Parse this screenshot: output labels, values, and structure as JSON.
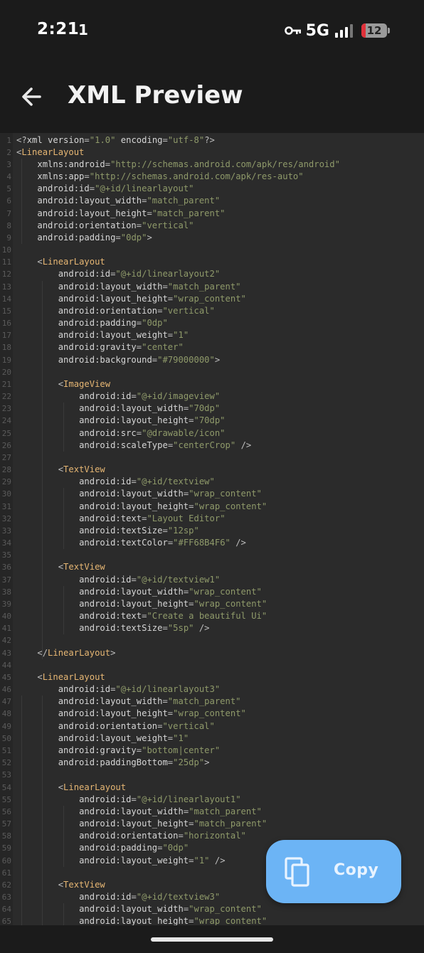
{
  "status_bar": {
    "time": "2:21",
    "sim_indicator": "1",
    "network": "5G",
    "battery_level": "12",
    "icons": [
      "key-icon",
      "signal-icon",
      "battery-icon"
    ]
  },
  "app_bar": {
    "title": "XML Preview",
    "back_icon": "arrow-left-icon"
  },
  "copy_button": {
    "label": "Copy",
    "icon": "copy-icon"
  },
  "colors": {
    "background": "#1b1b1b",
    "editor_background": "#2b2b2b",
    "tag": "#e6b673",
    "string": "#8f9a6a",
    "accent": "#6cb4f5"
  },
  "code_lines": [
    "<?xml version=\"1.0\" encoding=\"utf-8\"?>",
    "<LinearLayout",
    "    xmlns:android=\"http://schemas.android.com/apk/res/android\"",
    "    xmlns:app=\"http://schemas.android.com/apk/res-auto\"",
    "    android:id=\"@+id/linearlayout\"",
    "    android:layout_width=\"match_parent\"",
    "    android:layout_height=\"match_parent\"",
    "    android:orientation=\"vertical\"",
    "    android:padding=\"0dp\">",
    "",
    "    <LinearLayout",
    "        android:id=\"@+id/linearlayout2\"",
    "        android:layout_width=\"match_parent\"",
    "        android:layout_height=\"wrap_content\"",
    "        android:orientation=\"vertical\"",
    "        android:padding=\"0dp\"",
    "        android:layout_weight=\"1\"",
    "        android:gravity=\"center\"",
    "        android:background=\"#79000000\">",
    "",
    "        <ImageView",
    "            android:id=\"@+id/imageview\"",
    "            android:layout_width=\"70dp\"",
    "            android:layout_height=\"70dp\"",
    "            android:src=\"@drawable/icon\"",
    "            android:scaleType=\"centerCrop\" />",
    "",
    "        <TextView",
    "            android:id=\"@+id/textview\"",
    "            android:layout_width=\"wrap_content\"",
    "            android:layout_height=\"wrap_content\"",
    "            android:text=\"Layout Editor\"",
    "            android:textSize=\"12sp\"",
    "            android:textColor=\"#FF68B4F6\" />",
    "",
    "        <TextView",
    "            android:id=\"@+id/textview1\"",
    "            android:layout_width=\"wrap_content\"",
    "            android:layout_height=\"wrap_content\"",
    "            android:text=\"Create a beautiful Ui\"",
    "            android:textSize=\"5sp\" />",
    "",
    "    </LinearLayout>",
    "",
    "    <LinearLayout",
    "        android:id=\"@+id/linearlayout3\"",
    "        android:layout_width=\"match_parent\"",
    "        android:layout_height=\"wrap_content\"",
    "        android:orientation=\"vertical\"",
    "        android:layout_weight=\"1\"",
    "        android:gravity=\"bottom|center\"",
    "        android:paddingBottom=\"25dp\">",
    "",
    "        <LinearLayout",
    "            android:id=\"@+id/linearlayout1\"",
    "            android:layout_width=\"match_parent\"",
    "            android:layout_height=\"match_parent\"",
    "            android:orientation=\"horizontal\"",
    "            android:padding=\"0dp\"",
    "            android:layout_weight=\"1\" />",
    "",
    "        <TextView",
    "            android:id=\"@+id/textview3\"",
    "            android:layout_width=\"wrap_content\"",
    "            android:layout_height=\"wrap_content\""
  ]
}
